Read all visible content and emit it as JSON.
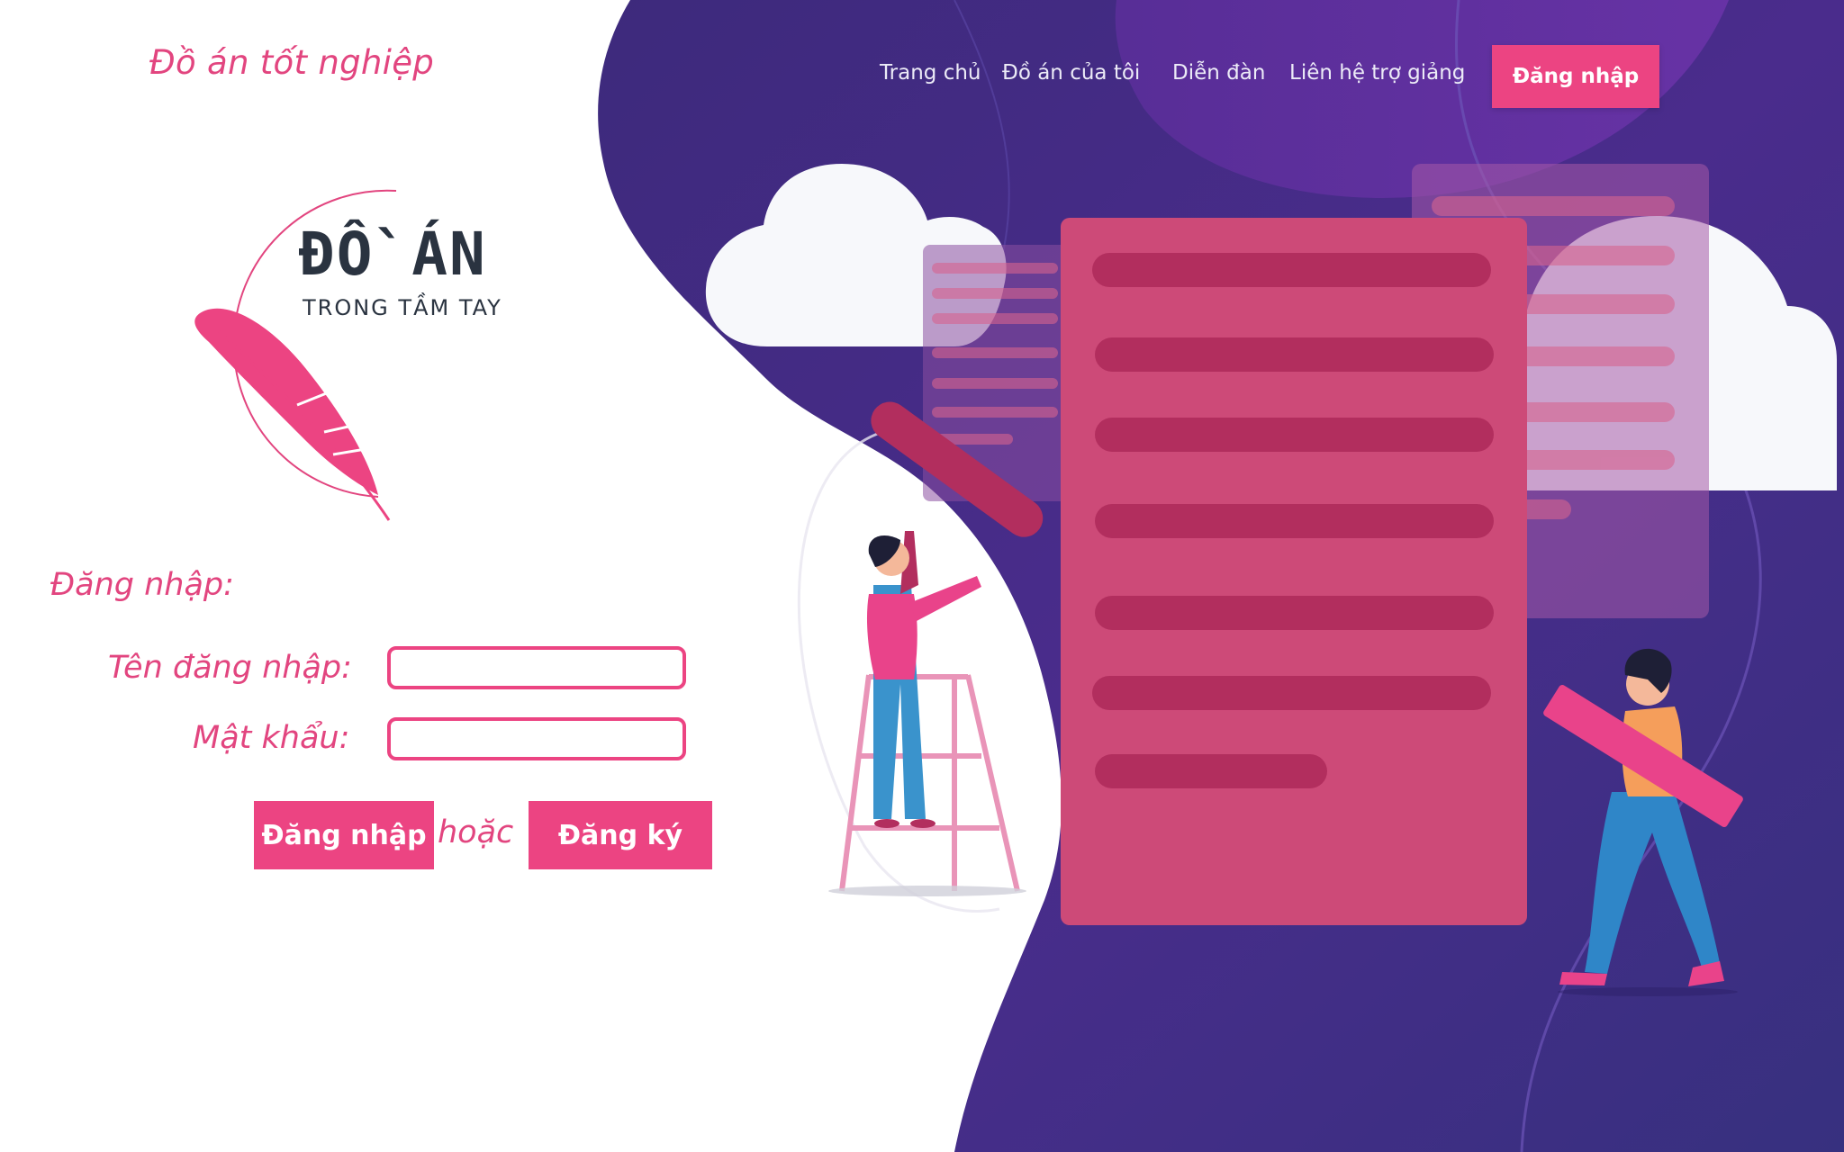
{
  "header": {
    "brand": "Đồ án tốt nghiệp",
    "nav": [
      "Trang chủ",
      "Đồ án của tôi",
      "Diễn đàn",
      "Liên hệ trợ giảng"
    ],
    "login_button": "Đăng nhập"
  },
  "logo": {
    "title": "ĐỒ ÁN",
    "subtitle": "TRONG TẦM TAY",
    "icon": "feather-icon"
  },
  "login_form": {
    "heading": "Đăng nhập:",
    "username_label": "Tên đăng nhập:",
    "username_value": "",
    "password_label": "Mật khẩu:",
    "password_value": "",
    "login_button": "Đăng nhập",
    "or_text": "hoặc",
    "register_button": "Đăng ký"
  },
  "colors": {
    "accent": "#ec4482",
    "background_purple": "#3f2a7f",
    "document": "#cd4a78"
  }
}
